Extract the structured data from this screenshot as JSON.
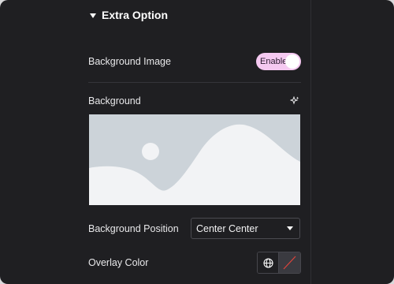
{
  "section": {
    "title": "Extra Option",
    "expanded": true
  },
  "background_image": {
    "label": "Background Image",
    "toggle_label": "Enable",
    "enabled": true
  },
  "background": {
    "label": "Background",
    "action_icon": "sparkle-icon",
    "placeholder_icon": "image-placeholder-icon"
  },
  "background_position": {
    "label": "Background Position",
    "value": "Center Center"
  },
  "overlay_color": {
    "label": "Overlay Color",
    "global_icon": "globe-icon",
    "swatch": "none"
  },
  "colors": {
    "panel_bg": "#1f1f22",
    "text": "#e8e8ea",
    "toggle_bg": "#f5c9f1",
    "placeholder_bg": "#ccd3d9",
    "placeholder_shape": "#f2f3f5",
    "no_color_slash": "#e0443b"
  }
}
